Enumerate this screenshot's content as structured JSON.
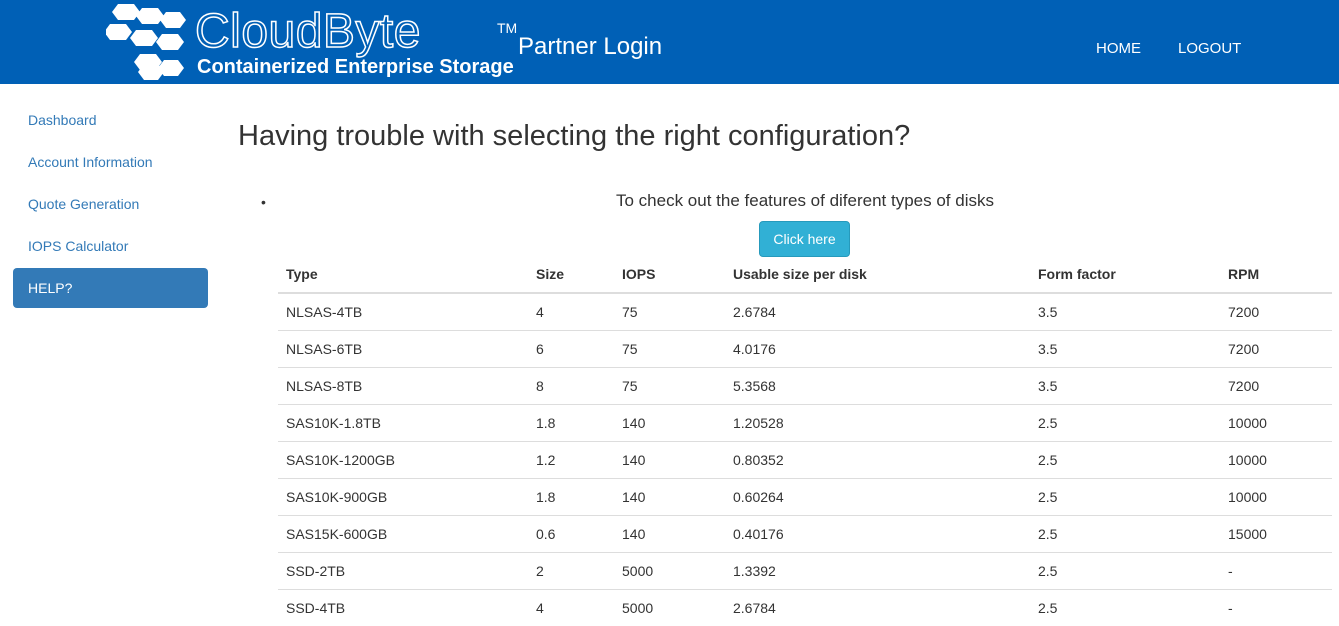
{
  "header": {
    "brand_name": "CloudByte",
    "brand_trademark": "TM",
    "brand_tagline": "Containerized Enterprise Storage",
    "portal_title": "Partner Login",
    "nav": [
      {
        "label": "HOME"
      },
      {
        "label": "LOGOUT"
      }
    ],
    "logo_icon": "hexagon-cluster-logo-icon"
  },
  "sidebar": {
    "items": [
      {
        "label": "Dashboard"
      },
      {
        "label": "Account Information"
      },
      {
        "label": "Quote Generation"
      },
      {
        "label": "IOPS Calculator"
      },
      {
        "label": "HELP?",
        "active": true
      }
    ]
  },
  "main": {
    "heading": "Having trouble with selecting the right configuration?",
    "bullet": "•",
    "info_text": "To check out the features of diferent types of disks",
    "button_label": "Click here",
    "table": {
      "headers": [
        "Type",
        "Size",
        "IOPS",
        "Usable size per disk",
        "Form factor",
        "RPM"
      ],
      "rows": [
        [
          "NLSAS-4TB",
          "4",
          "75",
          "2.6784",
          "3.5",
          "7200"
        ],
        [
          "NLSAS-6TB",
          "6",
          "75",
          "4.0176",
          "3.5",
          "7200"
        ],
        [
          "NLSAS-8TB",
          "8",
          "75",
          "5.3568",
          "3.5",
          "7200"
        ],
        [
          "SAS10K-1.8TB",
          "1.8",
          "140",
          "1.20528",
          "2.5",
          "10000"
        ],
        [
          "SAS10K-1200GB",
          "1.2",
          "140",
          "0.80352",
          "2.5",
          "10000"
        ],
        [
          "SAS10K-900GB",
          "1.8",
          "140",
          "0.60264",
          "2.5",
          "10000"
        ],
        [
          "SAS15K-600GB",
          "0.6",
          "140",
          "0.40176",
          "2.5",
          "15000"
        ],
        [
          "SSD-2TB",
          "2",
          "5000",
          "1.3392",
          "2.5",
          "-"
        ],
        [
          "SSD-4TB",
          "4",
          "5000",
          "2.6784",
          "2.5",
          "-"
        ]
      ]
    }
  },
  "colors": {
    "header_bg": "#0060b6",
    "link": "#337ab7",
    "active_bg": "#337ab7",
    "button_bg": "#31b0d5"
  }
}
